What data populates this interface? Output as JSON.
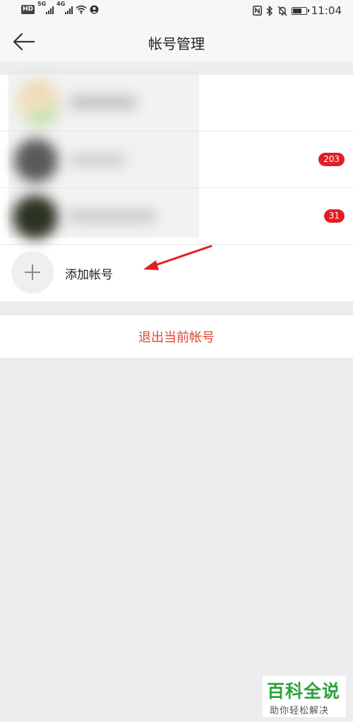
{
  "status_bar": {
    "left_icons": [
      "hd-icon",
      "signal-5g-icon",
      "signal-4g-icon",
      "wifi-icon",
      "location-icon"
    ],
    "signal_labels": [
      "5G",
      "4G"
    ],
    "hd_label": "HD",
    "right_icons": [
      "nfc-icon",
      "bluetooth-icon",
      "mute-icon",
      "battery-icon"
    ],
    "battery_level": 0.7,
    "time": "11:04"
  },
  "header": {
    "title": "帐号管理",
    "back_icon": "back-arrow-icon"
  },
  "accounts": [
    {
      "badge": ""
    },
    {
      "badge": "203"
    },
    {
      "badge": "31"
    }
  ],
  "add_account": {
    "label": "添加帐号",
    "icon": "plus-icon"
  },
  "logout": {
    "label": "退出当前帐号"
  },
  "annotation": {
    "icon": "red-arrow-icon",
    "color": "#e51c23"
  },
  "watermark": {
    "title": "百科全说",
    "subtitle": "助你轻松解决"
  },
  "colors": {
    "accent_red": "#e5432b",
    "badge_red": "#e51c23",
    "watermark_green": "#2ca33b"
  }
}
